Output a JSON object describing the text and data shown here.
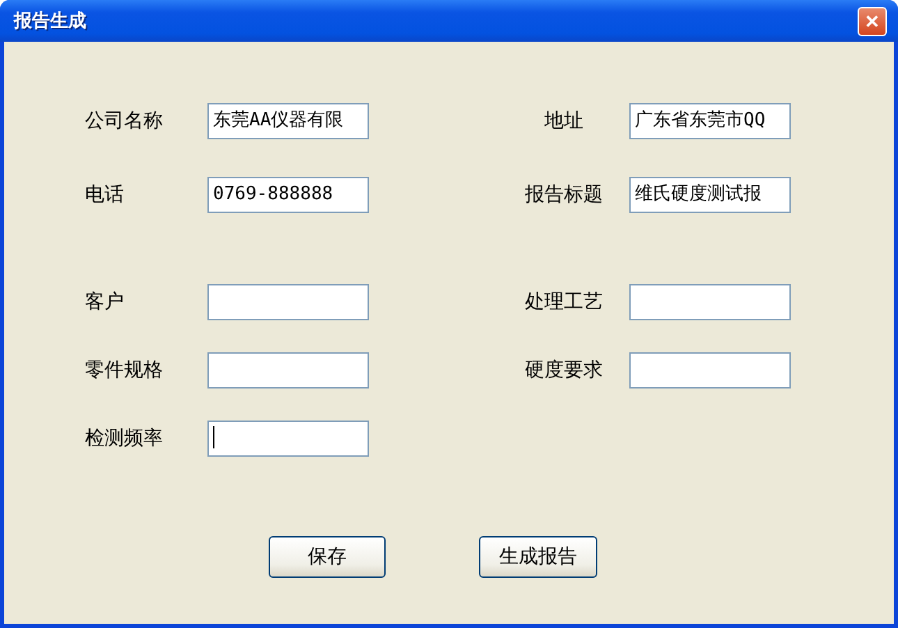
{
  "window": {
    "title": "报告生成",
    "close_button": "✕"
  },
  "sections": [
    [
      {
        "left": {
          "label": "公司名称",
          "value": "东莞AA仪器有限",
          "focused": false
        },
        "right": {
          "label": "地址",
          "value": "广东省东莞市QQ",
          "focused": false
        }
      },
      {
        "left": {
          "label": "电话",
          "value": "0769-888888",
          "focused": false
        },
        "right": {
          "label": "报告标题",
          "value": "维氏硬度测试报",
          "focused": false
        }
      }
    ],
    [
      {
        "left": {
          "label": "客户",
          "focused": false
        },
        "right": {
          "label": "处理工艺",
          "focused": false
        }
      },
      {
        "left": {
          "label": "零件规格",
          "focused": false
        },
        "right": {
          "label": "硬度要求",
          "focused": false
        }
      },
      {
        "left": {
          "label": "检测频率",
          "focused": true
        }
      }
    ]
  ],
  "buttons": [
    "保存",
    "生成报告"
  ]
}
